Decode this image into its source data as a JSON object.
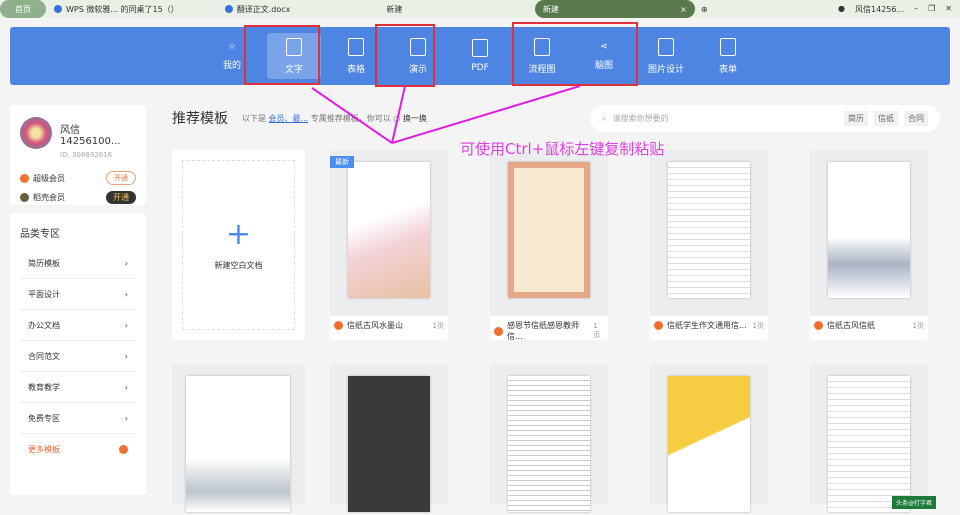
{
  "tabs": [
    {
      "label": "首页"
    },
    {
      "label": "WPS 微软雅... 的同桌了15（）"
    },
    {
      "label": "翻译正文.docx"
    },
    {
      "label": "新建"
    },
    {
      "label": "新建",
      "active": true
    }
  ],
  "account": "风信14256...",
  "nav": [
    {
      "label": "我的"
    },
    {
      "label": "文字",
      "selected": true
    },
    {
      "label": "表格"
    },
    {
      "label": "演示"
    },
    {
      "label": "PDF"
    },
    {
      "label": "流程图"
    },
    {
      "label": "脑图"
    },
    {
      "label": "图片设计"
    },
    {
      "label": "表单"
    }
  ],
  "user": {
    "name": "风信14256100...",
    "id": "ID: 306892616",
    "vips": [
      {
        "label": "超级会员",
        "button": "开通",
        "color": "#f07030"
      },
      {
        "label": "稻壳会员",
        "button": "开通",
        "color": "#6a5a40"
      }
    ]
  },
  "categories": {
    "title": "品类专区",
    "items": [
      "简历模板",
      "平面设计",
      "办公文档",
      "合同范文",
      "教育教学",
      "免费专区"
    ],
    "more": "更多模板"
  },
  "recommend": {
    "title": "推荐模板",
    "subtitle_pre": "以下是",
    "subtitle_link": "会员、最...",
    "subtitle_post": "专属推荐模板，你可以",
    "refresh": "换一换"
  },
  "search": {
    "placeholder": "请搜索你想要的",
    "tags": [
      "简历",
      "信纸",
      "合同"
    ]
  },
  "annotation": "可使用Ctrl+鼠标左键复制粘贴",
  "blank": {
    "label": "新建空白文档"
  },
  "templates": [
    {
      "title": "信纸古风水墨山",
      "pages": "1页",
      "badge": "最新"
    },
    {
      "title": "感恩节信纸感恩教师信...",
      "pages": "1页"
    },
    {
      "title": "信纸学生作文通用信...",
      "pages": "1页"
    },
    {
      "title": "信纸古风信纸",
      "pages": "1页"
    }
  ],
  "watermark": "头条@打字君"
}
